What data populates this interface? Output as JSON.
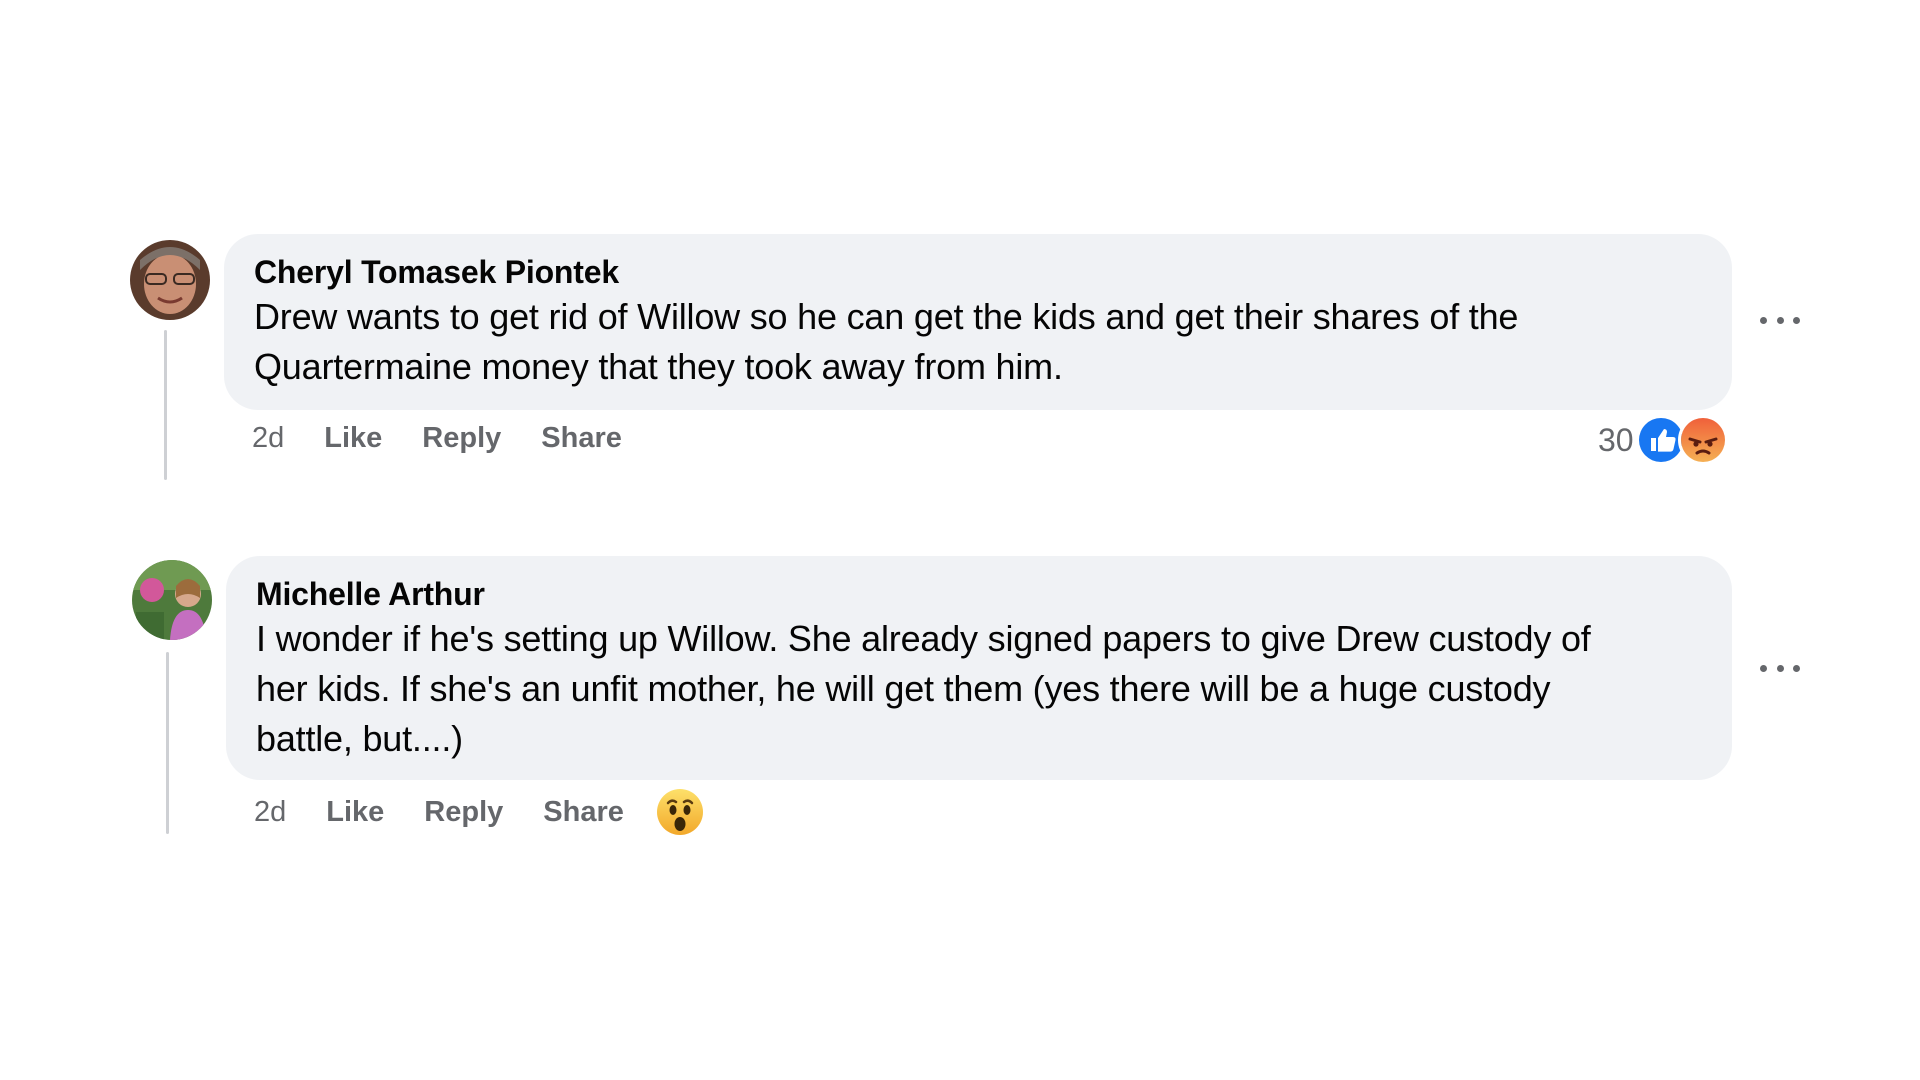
{
  "comments": [
    {
      "author": "Cheryl Tomasek Piontek",
      "text_line1": "Drew wants to get rid of Willow so he can get the kids and get their shares of the",
      "text_line2": "Quartermaine money that they took away from him.",
      "time": "2d",
      "like_label": "Like",
      "reply_label": "Reply",
      "share_label": "Share",
      "reaction_count": "30",
      "reactions": [
        "like",
        "angry"
      ]
    },
    {
      "author": "Michelle Arthur",
      "text_line1": "I wonder if he's setting up Willow. She already signed papers to give Drew custody of",
      "text_line2": "her kids. If she's an unfit mother, he will get them (yes there will be a huge custody",
      "text_line3": "battle, but....)",
      "time": "2d",
      "like_label": "Like",
      "reply_label": "Reply",
      "share_label": "Share",
      "reactions": [
        "wow"
      ]
    }
  ],
  "icons": {
    "more": "more-options-icon",
    "like": "like-reaction-icon",
    "angry": "angry-reaction-icon",
    "wow": "wow-reaction-icon"
  },
  "colors": {
    "bubble": "#f0f2f5",
    "secondary_text": "#65676b",
    "like_blue": "#1877f2",
    "angry_orange": "#f0603a",
    "wow_yellow": "#f7c33b"
  }
}
